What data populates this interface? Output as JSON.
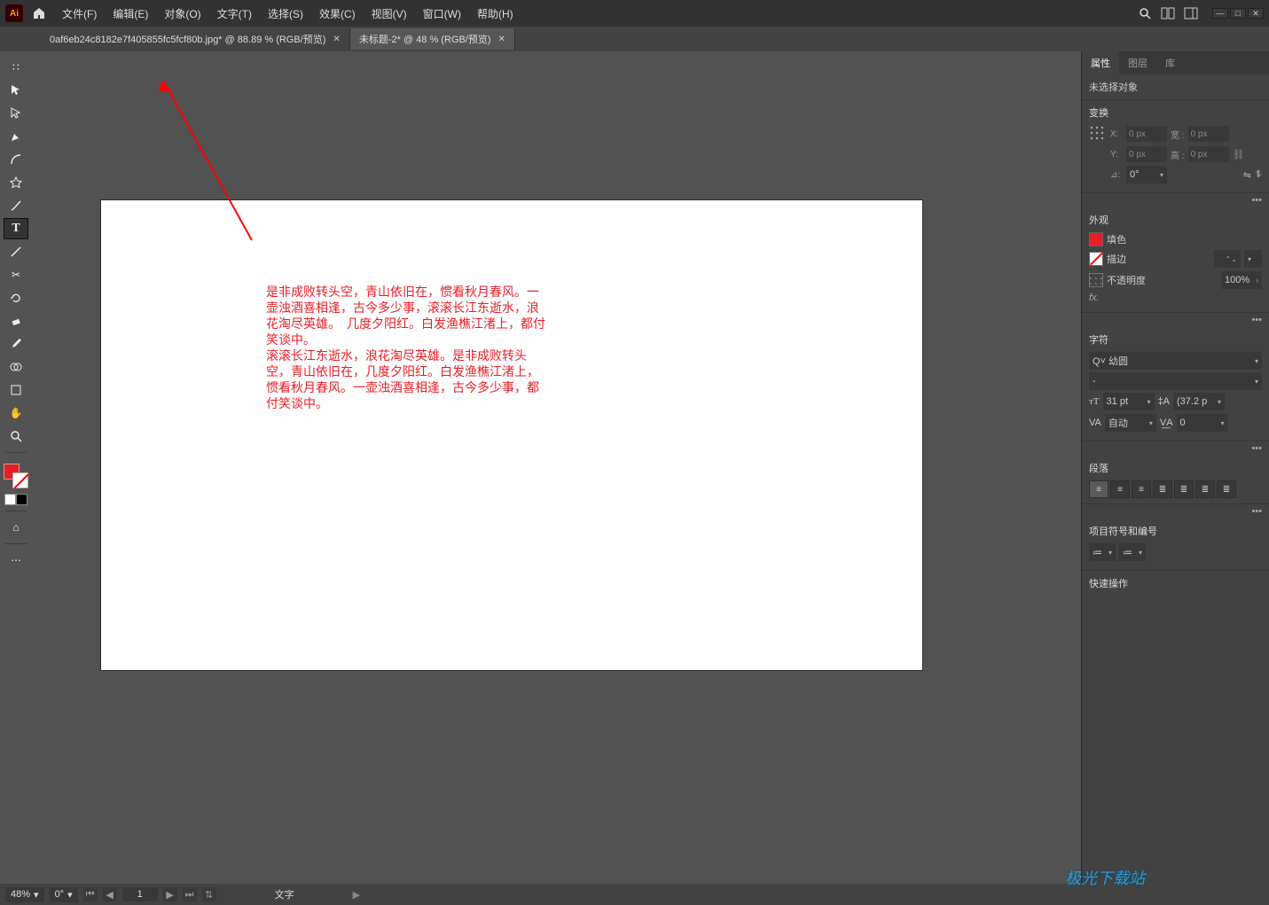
{
  "app": {
    "logo_text": "Ai"
  },
  "menu": {
    "file": "文件(F)",
    "edit": "编辑(E)",
    "object": "对象(O)",
    "type": "文字(T)",
    "select": "选择(S)",
    "effect": "效果(C)",
    "view": "视图(V)",
    "window": "窗口(W)",
    "help": "帮助(H)"
  },
  "tabs": {
    "t1": "0af6eb24c8182e7f405855fc5fcf80b.jpg* @ 88.89 % (RGB/预览)",
    "t2": "未标题-2* @ 48 % (RGB/预览)"
  },
  "canvas_text": "是非成败转头空，青山依旧在，惯看秋月春风。一壶浊酒喜相逢，古今多少事，滚滚长江东逝水，浪花淘尽英雄。  几度夕阳红。白发渔樵江渚上，都付笑谈中。\n滚滚长江东逝水，浪花淘尽英雄。是非成败转头空，青山依旧在，几度夕阳红。白发渔樵江渚上，惯看秋月春风。一壶浊酒喜相逢，古今多少事，都付笑谈中。",
  "panel": {
    "tabs": {
      "props": "属性",
      "layers": "图层",
      "lib": "库"
    },
    "nosel": "未选择对象",
    "transform": {
      "h": "变换",
      "x": "X:",
      "y": "Y:",
      "w": "宽 :",
      "ht": "高 :",
      "xv": "0 px",
      "yv": "0 px",
      "wv": "0 px",
      "hv": "0 px",
      "angle": "⊿:",
      "av": "0°"
    },
    "appearance": {
      "h": "外观",
      "fill": "填色",
      "stroke": "描边",
      "opacity": "不透明度",
      "opv": "100%",
      "fx": "fx."
    },
    "char": {
      "h": "字符",
      "font": "幼圆",
      "style": "-",
      "size": "31 pt",
      "leading": "(37.2 p",
      "kern": "自动",
      "track": "0"
    },
    "para": {
      "h": "段落"
    },
    "bullets": {
      "h": "项目符号和编号"
    },
    "quick": {
      "h": "快速操作"
    }
  },
  "status": {
    "zoom": "48%",
    "rot": "0°",
    "page": "1",
    "mode": "文字"
  },
  "watermark": "极光下载站"
}
